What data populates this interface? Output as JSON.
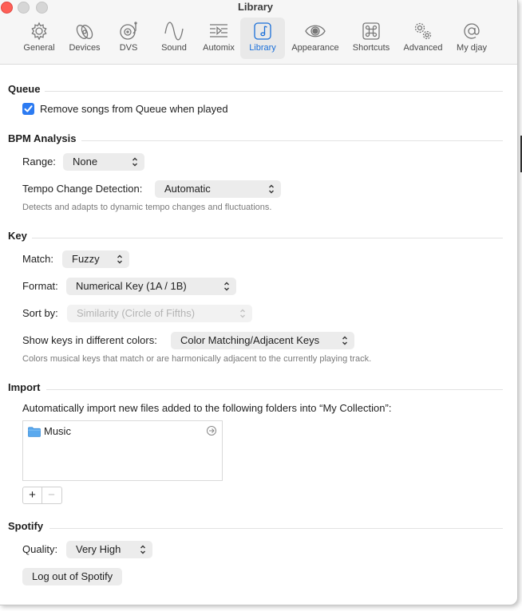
{
  "window": {
    "title": "Library"
  },
  "toolbar": {
    "tabs": [
      {
        "label": "General",
        "icon": "gear-icon"
      },
      {
        "label": "Devices",
        "icon": "devices-icon"
      },
      {
        "label": "DVS",
        "icon": "turntable-icon"
      },
      {
        "label": "Sound",
        "icon": "waveform-icon"
      },
      {
        "label": "Automix",
        "icon": "automix-icon"
      },
      {
        "label": "Library",
        "icon": "music-note-icon",
        "active": true
      },
      {
        "label": "Appearance",
        "icon": "eye-icon"
      },
      {
        "label": "Shortcuts",
        "icon": "command-icon"
      },
      {
        "label": "Advanced",
        "icon": "gears-icon"
      },
      {
        "label": "My djay",
        "icon": "at-sign-icon"
      }
    ]
  },
  "queue": {
    "heading": "Queue",
    "remove_played_label": "Remove songs from Queue when played",
    "remove_played_checked": true
  },
  "bpm": {
    "heading": "BPM Analysis",
    "range_label": "Range:",
    "range_value": "None",
    "tempo_label": "Tempo Change Detection:",
    "tempo_value": "Automatic",
    "tempo_help": "Detects and adapts to dynamic tempo changes and fluctuations."
  },
  "key": {
    "heading": "Key",
    "match_label": "Match:",
    "match_value": "Fuzzy",
    "format_label": "Format:",
    "format_value": "Numerical Key (1A / 1B)",
    "sort_label": "Sort by:",
    "sort_value": "Similarity (Circle of Fifths)",
    "colors_label": "Show keys in different colors:",
    "colors_value": "Color Matching/Adjacent Keys",
    "colors_help": "Colors musical keys that match or are harmonically adjacent to the currently playing track."
  },
  "import": {
    "heading": "Import",
    "description": "Automatically import new files added to the following folders into “My Collection”:",
    "folders": [
      {
        "name": "Music"
      }
    ],
    "add_label": "+",
    "remove_label": "−"
  },
  "spotify": {
    "heading": "Spotify",
    "quality_label": "Quality:",
    "quality_value": "Very High",
    "logout_label": "Log out of Spotify"
  },
  "colors": {
    "accent": "#2c7bf2",
    "active_tab": "#1a6fd9",
    "close": "#fe5f57"
  }
}
